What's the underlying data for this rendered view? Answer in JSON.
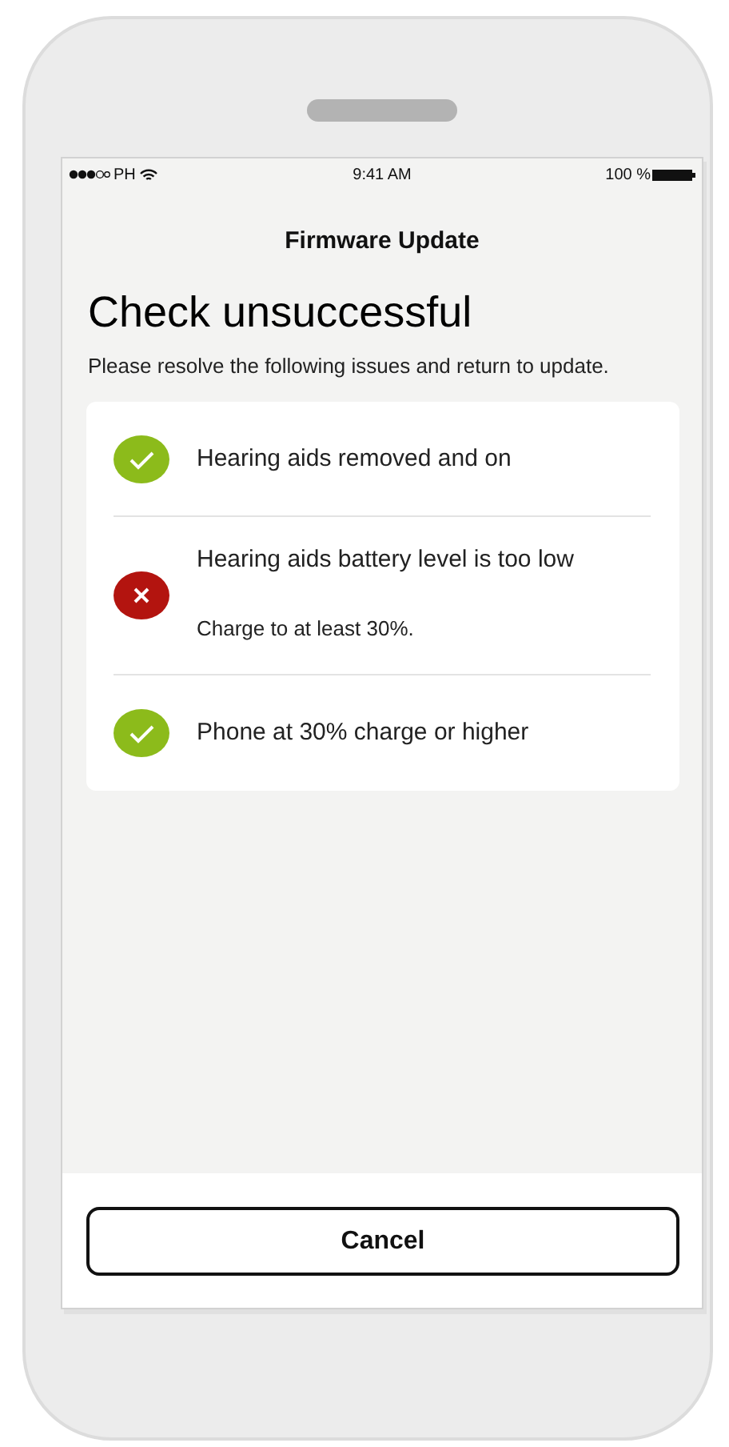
{
  "status_bar": {
    "carrier": "PH",
    "time": "9:41 AM",
    "battery": "100 %"
  },
  "nav_title": "Firmware Update",
  "heading": "Check unsuccessful",
  "description": "Please resolve the following issues and return to update.",
  "checks": [
    {
      "kind": "pass",
      "text": "Hearing aids removed and on"
    },
    {
      "kind": "fail",
      "text": "Hearing aids battery level is too low",
      "note": "Charge to at least 30%."
    },
    {
      "kind": "pass",
      "text": "Phone at 30% charge or higher"
    }
  ],
  "buttons": [
    "Cancel"
  ]
}
